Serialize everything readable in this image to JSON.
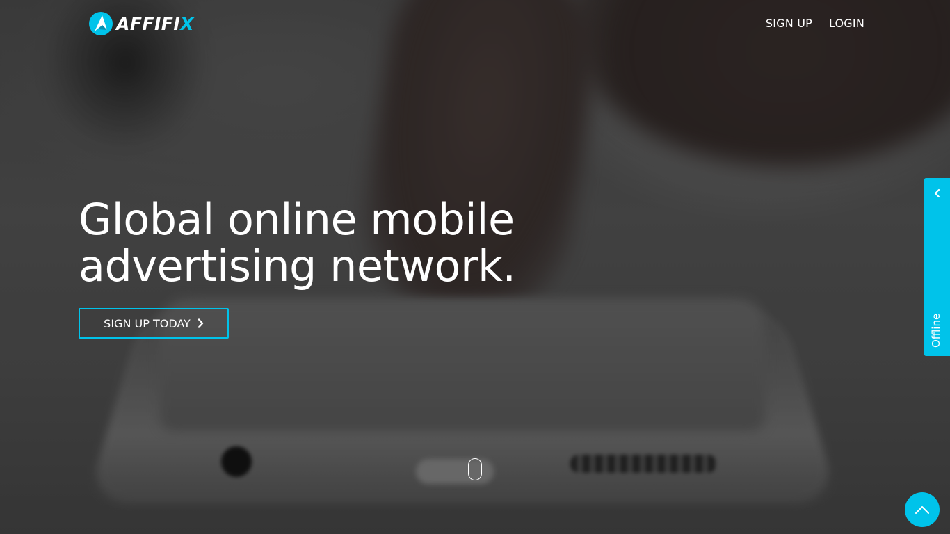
{
  "brand": {
    "logo_text": "AFFIFI",
    "logo_text_accent": "X",
    "accent_color": "#00c3ea"
  },
  "nav": {
    "signup_label": "SIGN UP",
    "login_label": "LOGIN"
  },
  "hero": {
    "title_line1": "Global online mobile",
    "title_line2": "advertising network.",
    "cta_label": "SIGN UP TODAY",
    "cta_icon": "chevron-right-icon"
  },
  "scroll_indicator": {
    "icon": "mouse-scroll-icon"
  },
  "chat_widget": {
    "status_label": "Offline",
    "toggle_icon": "chevron-left-icon"
  },
  "back_to_top": {
    "icon": "chevron-up-icon"
  }
}
